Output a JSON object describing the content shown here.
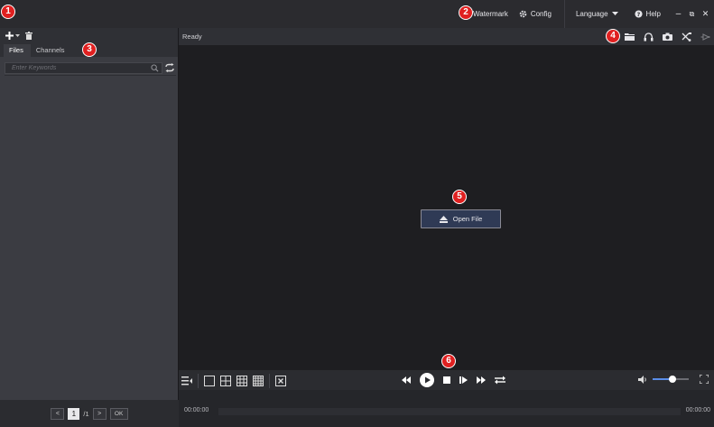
{
  "badges": [
    "1",
    "2",
    "3",
    "4",
    "5",
    "6"
  ],
  "titlebar": {
    "watermark": "Watermark",
    "config": "Config",
    "language": "Language",
    "help": "Help",
    "minimize": "–",
    "restore": "⧉",
    "close": "✕"
  },
  "left_panel": {
    "tabs": [
      {
        "label": "Files"
      },
      {
        "label": "Channels"
      }
    ],
    "active_tab": "Files",
    "search": {
      "placeholder": "Enter Keywords",
      "value": ""
    },
    "pager": {
      "prev": "<",
      "page": "1",
      "total": "/1",
      "next": ">",
      "ok": "OK"
    }
  },
  "main": {
    "status": "Ready",
    "open_file": "Open File"
  },
  "timeline": {
    "current": "00:00:00",
    "end": "00:00:00"
  },
  "volume": {
    "level": 0.55
  },
  "colors": {
    "accent": "#5a8ee8",
    "badge": "#e02020",
    "button_bg": "#2f3a55"
  }
}
